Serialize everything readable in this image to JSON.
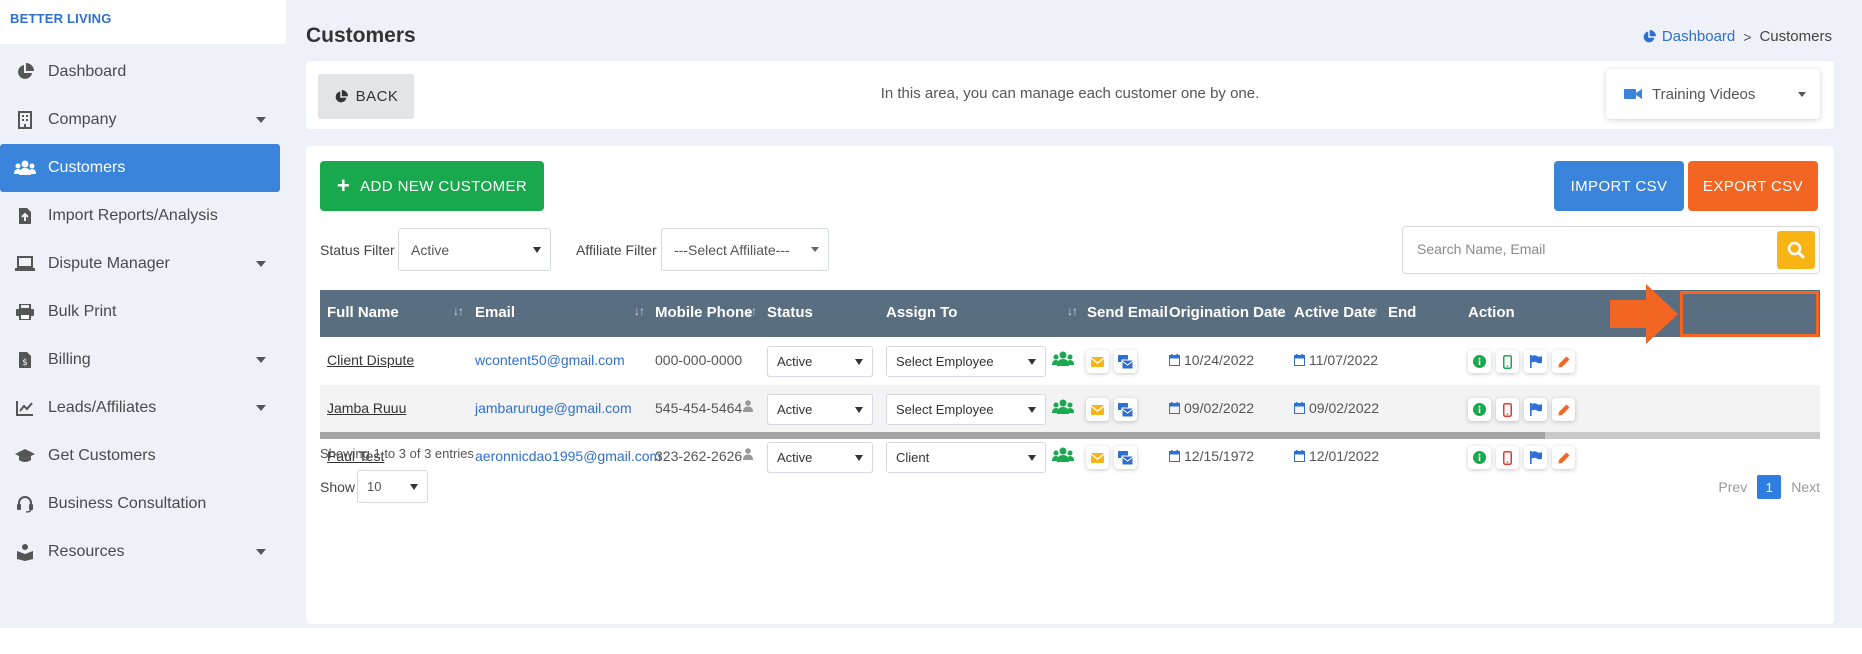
{
  "brand": "BETTER LIVING",
  "sidebar": {
    "items": [
      {
        "label": "Dashboard",
        "icon": "pie-chart-icon",
        "caret": false,
        "active": false
      },
      {
        "label": "Company",
        "icon": "building-icon",
        "caret": true,
        "active": false
      },
      {
        "label": "Customers",
        "icon": "users-icon",
        "caret": false,
        "active": true
      },
      {
        "label": "Import Reports/Analysis",
        "icon": "file-import-icon",
        "caret": false,
        "active": false
      },
      {
        "label": "Dispute Manager",
        "icon": "laptop-icon",
        "caret": true,
        "active": false
      },
      {
        "label": "Bulk Print",
        "icon": "print-icon",
        "caret": false,
        "active": false
      },
      {
        "label": "Billing",
        "icon": "invoice-icon",
        "caret": true,
        "active": false
      },
      {
        "label": "Leads/Affiliates",
        "icon": "chart-line-icon",
        "caret": true,
        "active": false
      },
      {
        "label": "Get Customers",
        "icon": "graduation-cap-icon",
        "caret": false,
        "active": false
      },
      {
        "label": "Business Consultation",
        "icon": "headset-icon",
        "caret": false,
        "active": false
      },
      {
        "label": "Resources",
        "icon": "book-reader-icon",
        "caret": true,
        "active": false
      }
    ]
  },
  "header": {
    "title": "Customers",
    "breadcrumb": {
      "home": "Dashboard",
      "separator": ">",
      "current": "Customers"
    }
  },
  "top_card": {
    "back_label": "BACK",
    "info": "In this area, you can manage each customer one by one.",
    "training_label": "Training Videos"
  },
  "toolbar": {
    "add_label": "ADD NEW CUSTOMER",
    "import_label": "IMPORT CSV",
    "export_label": "EXPORT CSV"
  },
  "filters": {
    "status_label": "Status Filter",
    "status_value": "Active",
    "affiliate_label": "Affiliate Filter",
    "affiliate_value": "---Select Affiliate---",
    "search_placeholder": "Search Name, Email"
  },
  "table": {
    "columns": {
      "full_name": "Full Name",
      "email": "Email",
      "mobile_phone": "Mobile Phone",
      "status": "Status",
      "assign_to": "Assign To",
      "send_email": "Send Email",
      "origination_date": "Origination Date",
      "active_date": "Active Date",
      "end_partial": "End",
      "action": "Action"
    },
    "rows": [
      {
        "name": "Client Dispute",
        "email": "wcontent50@gmail.com",
        "phone": "000-000-0000",
        "phone_user_icon": false,
        "status": "Active",
        "assign": "Select Employee",
        "origination": "10/24/2022",
        "active": "11/07/2022",
        "phone_icon_color": "#1aa84f"
      },
      {
        "name": "Jamba Ruuu",
        "email": "jambaruruge@gmail.com",
        "phone": "545-454-5464",
        "phone_user_icon": true,
        "status": "Active",
        "assign": "Select Employee",
        "origination": "09/02/2022",
        "active": "09/02/2022",
        "phone_icon_color": "#e53935"
      },
      {
        "name": "Paul Test",
        "email": "aeronnicdao1995@gmail.com",
        "phone": "323-262-2626",
        "phone_user_icon": true,
        "status": "Active",
        "assign": "Client",
        "origination": "12/15/1972",
        "active": "12/01/2022",
        "phone_icon_color": "#e53935"
      }
    ]
  },
  "footer": {
    "entries": "Showing 1 to 3 of 3 entries",
    "show_label": "Show",
    "page_size": "10",
    "prev": "Prev",
    "page": "1",
    "next": "Next"
  },
  "colors": {
    "primary": "#3b84dc",
    "success": "#1aa84f",
    "warning": "#f8b315",
    "danger": "#f26522",
    "table_header": "#5a6e82"
  }
}
